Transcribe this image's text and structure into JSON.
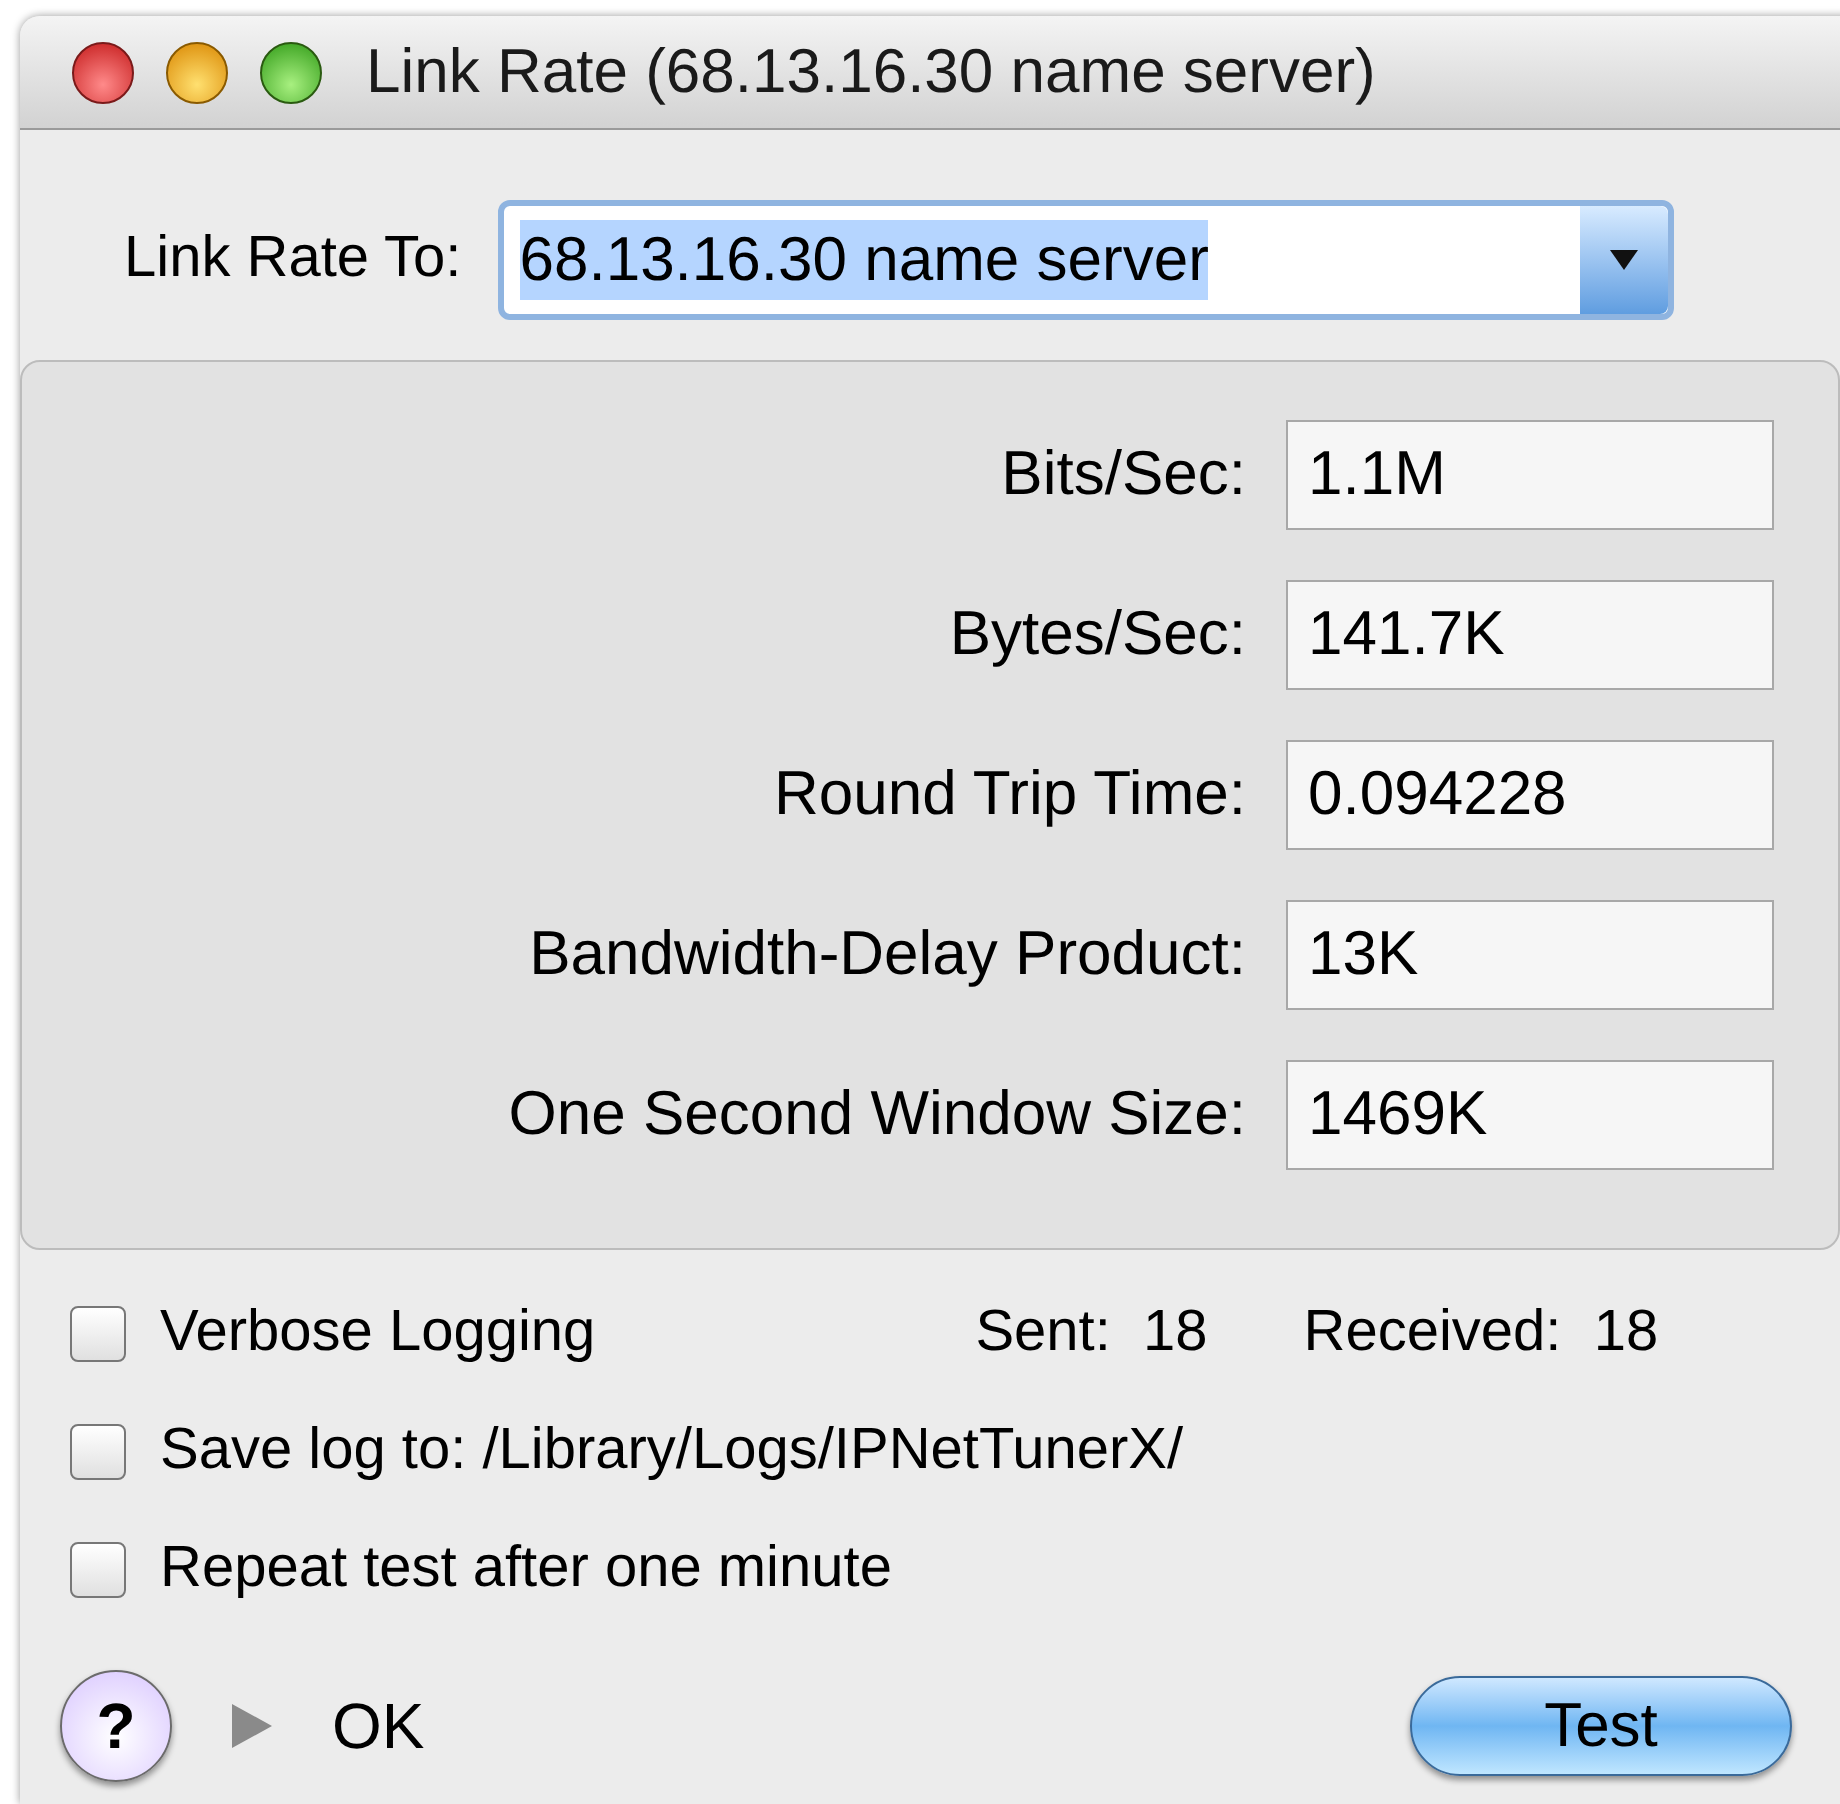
{
  "window": {
    "title": "Link Rate (68.13.16.30 name server)"
  },
  "target": {
    "label": "Link Rate To:",
    "value": "68.13.16.30 name server"
  },
  "results": [
    {
      "label": "Bits/Sec:",
      "value": "1.1M"
    },
    {
      "label": "Bytes/Sec:",
      "value": "141.7K"
    },
    {
      "label": "Round Trip Time:",
      "value": "0.094228"
    },
    {
      "label": "Bandwidth-Delay Product:",
      "value": "13K"
    },
    {
      "label": "One Second Window Size:",
      "value": "1469K"
    }
  ],
  "options": [
    {
      "label": "Verbose Logging",
      "checked": false
    },
    {
      "label": "Save log to: /Library/Logs/IPNetTunerX/",
      "checked": false
    },
    {
      "label": "Repeat test after one minute",
      "checked": false
    }
  ],
  "counters": [
    {
      "label": "Sent:",
      "value": "18"
    },
    {
      "label": "Received:",
      "value": "18"
    }
  ],
  "footer": {
    "help": "?",
    "status": "OK",
    "button": "Test"
  }
}
